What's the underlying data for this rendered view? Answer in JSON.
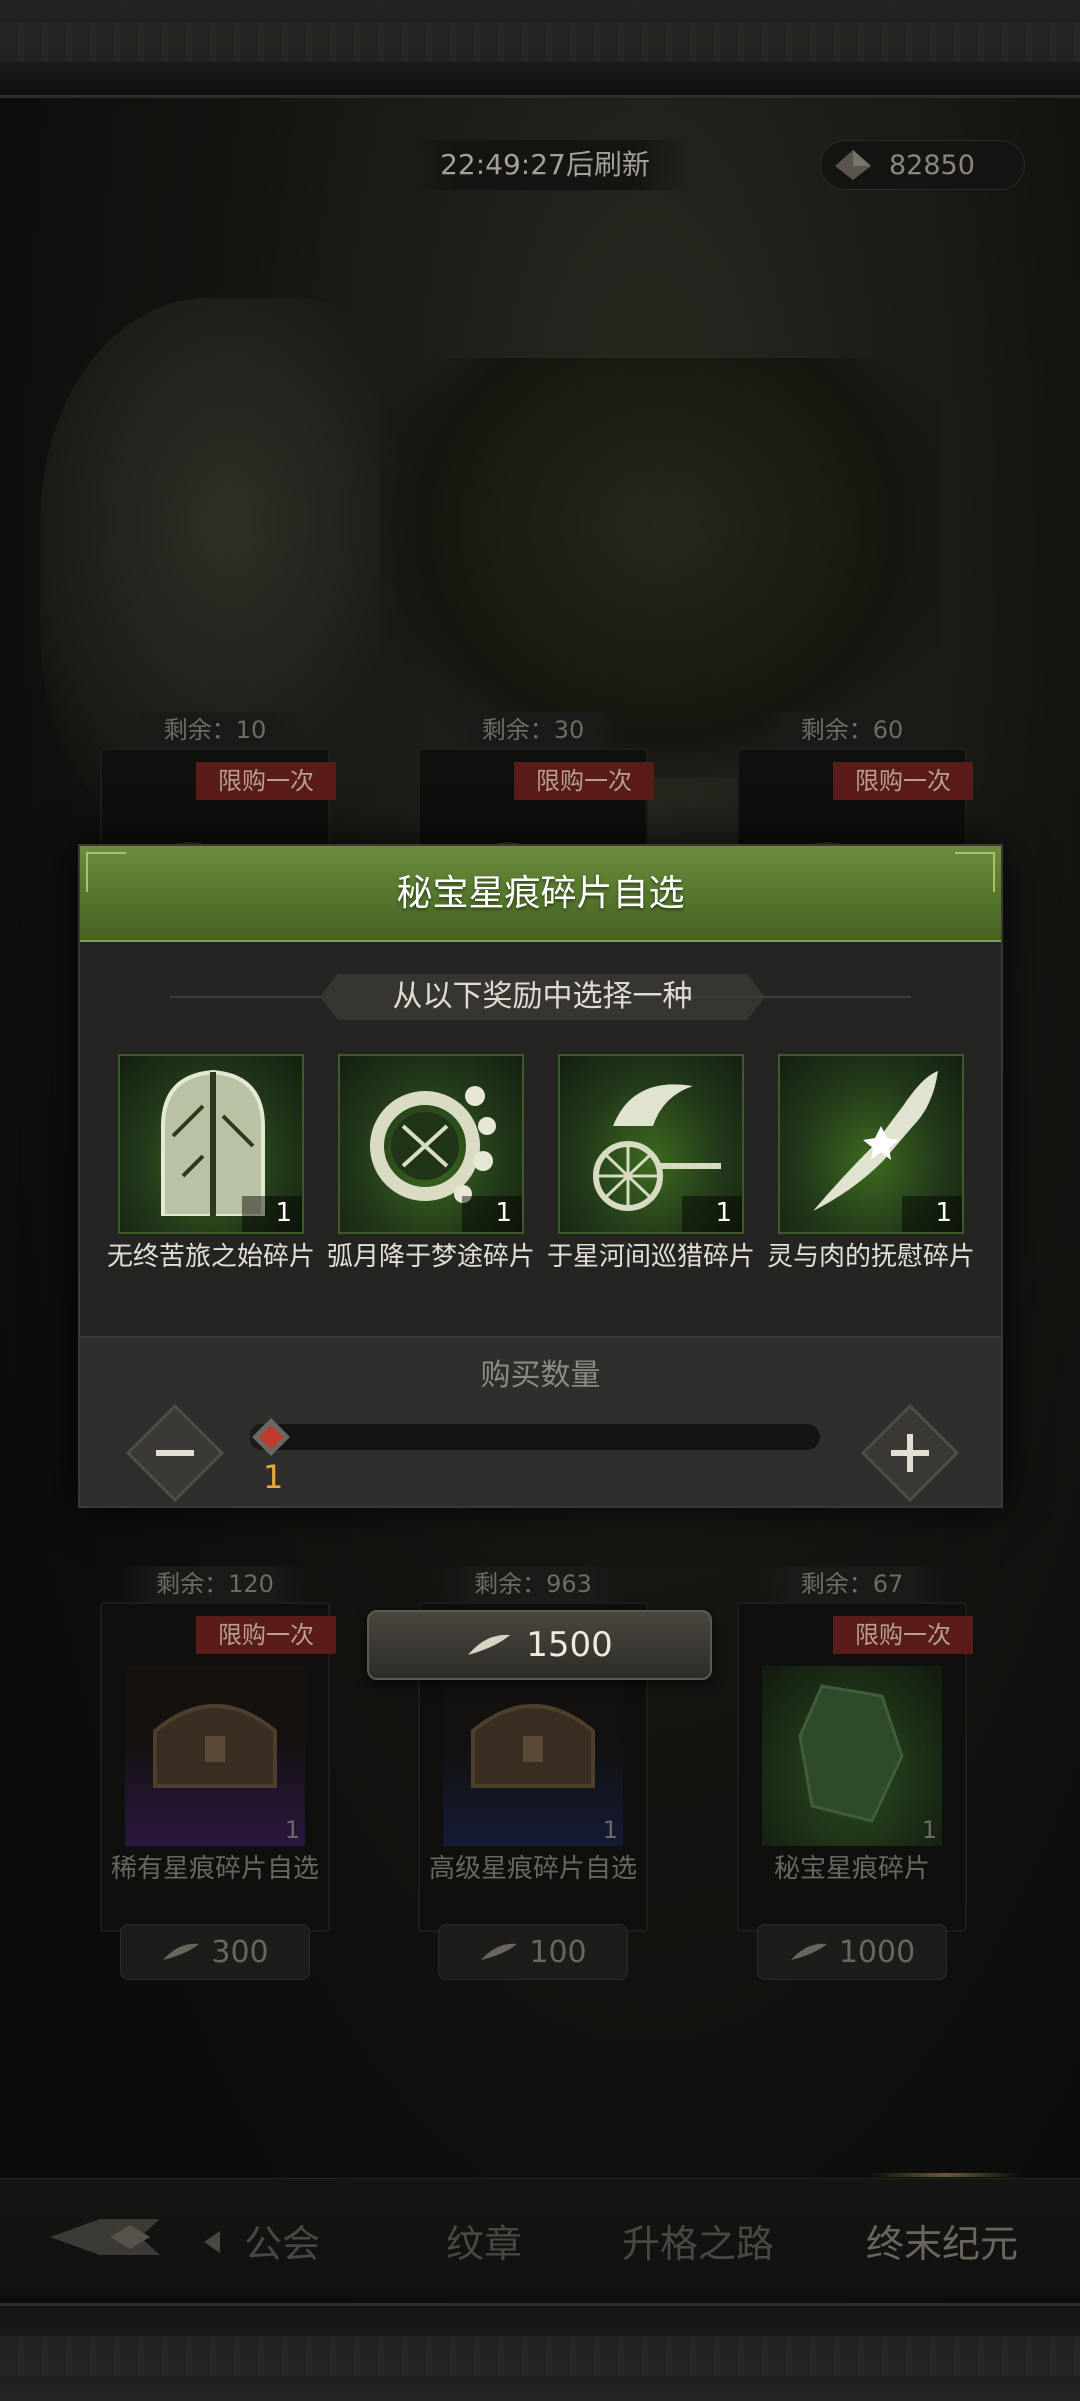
{
  "header": {
    "refresh_timer": "22:49:27后刷新",
    "currency_amount": "82850"
  },
  "shop": {
    "row1": [
      {
        "remaining": "剩余：10",
        "tag": "限购一次"
      },
      {
        "remaining": "剩余：30",
        "tag": "限购一次"
      },
      {
        "remaining": "剩余：60",
        "tag": "限购一次"
      }
    ],
    "row2": [
      {
        "remaining": "剩余：120",
        "tag": "限购一次",
        "qty": "1",
        "name": "稀有星痕碎片自选",
        "price": "300",
        "thumb_color": "#2b1740"
      },
      {
        "remaining": "剩余：963",
        "tag": "",
        "qty": "1",
        "name": "高级星痕碎片自选",
        "price": "100",
        "thumb_color": "#141a33"
      },
      {
        "remaining": "剩余：67",
        "tag": "限购一次",
        "qty": "1",
        "name": "秘宝星痕碎片",
        "price": "1000",
        "thumb_color": "#1a2b16"
      }
    ],
    "floating_price": "1500"
  },
  "modal": {
    "title": "秘宝星痕碎片自选",
    "subtitle": "从以下奖励中选择一种",
    "rewards": [
      {
        "name": "无终苦旅之始碎片",
        "qty": "1",
        "icon": "stained-glass-door-icon"
      },
      {
        "name": "弧月降于梦途碎片",
        "qty": "1",
        "icon": "crescent-moon-wreath-icon"
      },
      {
        "name": "于星河间巡猎碎片",
        "qty": "1",
        "icon": "winged-chariot-icon"
      },
      {
        "name": "灵与肉的抚慰碎片",
        "qty": "1",
        "icon": "feather-blade-icon"
      }
    ],
    "quantity_label": "购买数量",
    "quantity_value": "1",
    "quantity_fraction": 0.0
  },
  "nav": {
    "tabs": [
      "公会",
      "纹章",
      "升格之路",
      "终末纪元"
    ],
    "active": "终末纪元"
  },
  "colors": {
    "accent_green": "#55762c",
    "limit_tag": "#5a1c18",
    "quantity_gold": "#e6a93a"
  }
}
